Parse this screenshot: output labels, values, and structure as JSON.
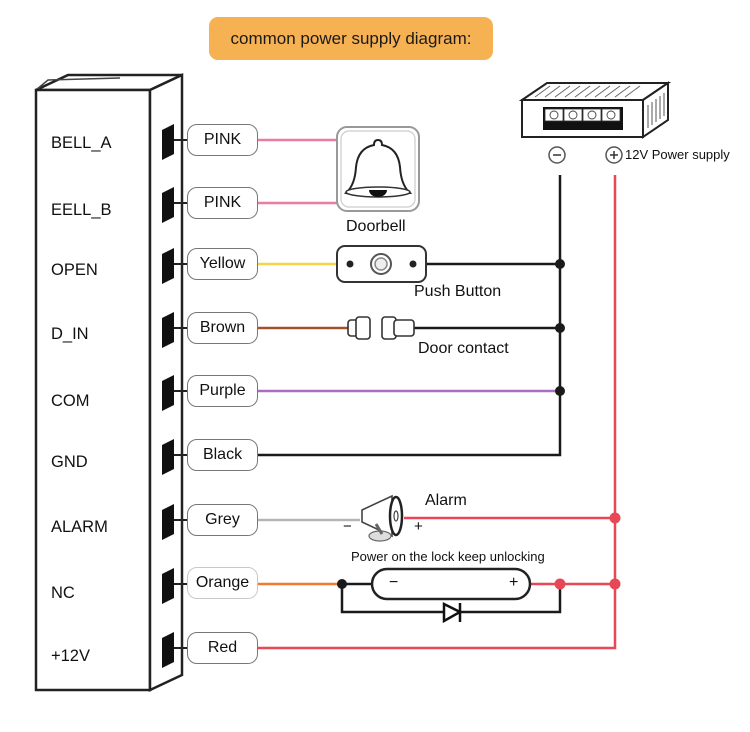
{
  "title": "common power supply diagram:",
  "controller": {
    "pins": [
      {
        "label": "BELL_A",
        "wire": "PINK",
        "wire_color": "#e87fa0"
      },
      {
        "label": "EELL_B",
        "wire": "PINK",
        "wire_color": "#e87fa0"
      },
      {
        "label": "OPEN",
        "wire": "Yellow",
        "wire_color": "#f5d547"
      },
      {
        "label": "D_IN",
        "wire": "Brown",
        "wire_color": "#a0522d"
      },
      {
        "label": "COM",
        "wire": "Purple",
        "wire_color": "#a86fbf"
      },
      {
        "label": "GND",
        "wire": "Black",
        "wire_color": "#1a1a1a"
      },
      {
        "label": "ALARM",
        "wire": "Grey",
        "wire_color": "#b5b5b5"
      },
      {
        "label": "NC",
        "wire": "Orange",
        "wire_color": "#f07a30"
      },
      {
        "label": "+12V",
        "wire": "Red",
        "wire_color": "#e84855"
      }
    ]
  },
  "components": {
    "doorbell": "Doorbell",
    "push_button": "Push Button",
    "door_contact": "Door contact",
    "alarm": "Alarm",
    "alarm_minus": "−",
    "alarm_plus": "+",
    "lock_caption": "Power on the lock keep unlocking",
    "lock_minus": "−",
    "lock_plus": "+",
    "power_supply": "12V Power supply",
    "ps_minus_symbol": "⊖",
    "ps_plus_symbol": "⊕"
  },
  "colors": {
    "title_bg": "#f6b152",
    "negative_bus": "#1a1a1a",
    "positive_bus": "#e84855"
  }
}
